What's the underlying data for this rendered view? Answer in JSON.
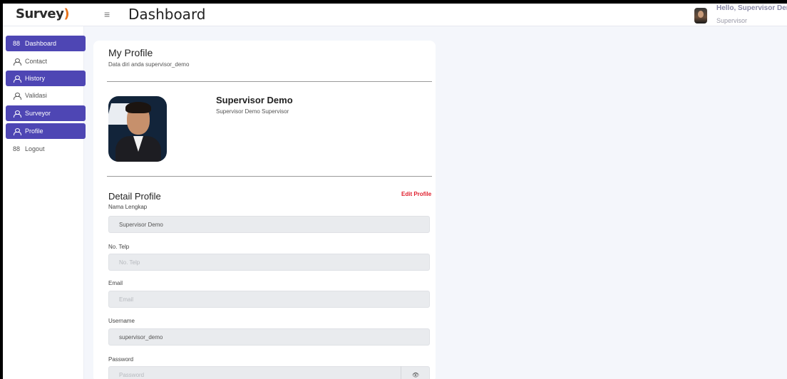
{
  "brand": {
    "name_main": "Survey",
    "name_bracket": ")"
  },
  "header": {
    "menu_icon": "hamburger-icon",
    "title": "Dashboard",
    "user_greeting": "Hello, Supervisor Demo",
    "user_role": "Supervisor"
  },
  "sidebar": {
    "items": [
      {
        "label": "Dashboard",
        "icon": "grid-icon",
        "active": true
      },
      {
        "label": "Contact",
        "icon": "user-icon",
        "active": false
      },
      {
        "label": "History",
        "icon": "user-icon",
        "active": true
      },
      {
        "label": "Validasi",
        "icon": "user-icon",
        "active": false
      },
      {
        "label": "Surveyor",
        "icon": "user-icon",
        "active": true
      },
      {
        "label": "Profile",
        "icon": "user-icon",
        "active": true
      },
      {
        "label": "Logout",
        "icon": "grid-icon",
        "active": false
      }
    ]
  },
  "profile": {
    "title": "My Profile",
    "subtitle": "Data diri anda supervisor_demo",
    "name": "Supervisor Demo",
    "description": "Supervisor Demo Supervisor"
  },
  "detail": {
    "title": "Detail Profile",
    "edit_label": "Edit Profile",
    "fields": [
      {
        "label": "Nama Lengkap",
        "value": "Supervisor Demo",
        "placeholder": ""
      },
      {
        "label": "No. Telp",
        "value": "",
        "placeholder": "No. Telp"
      },
      {
        "label": "Email",
        "value": "",
        "placeholder": "Email"
      },
      {
        "label": "Username",
        "value": "supervisor_demo",
        "placeholder": ""
      },
      {
        "label": "Password",
        "value": "",
        "placeholder": "Password"
      }
    ],
    "password_toggle_icon": "eye-icon",
    "password_toggle_glyph": "👁"
  },
  "colors": {
    "accent": "#4e46b4",
    "edit_link": "#e0202e",
    "brand_bracket": "#e8731c"
  }
}
